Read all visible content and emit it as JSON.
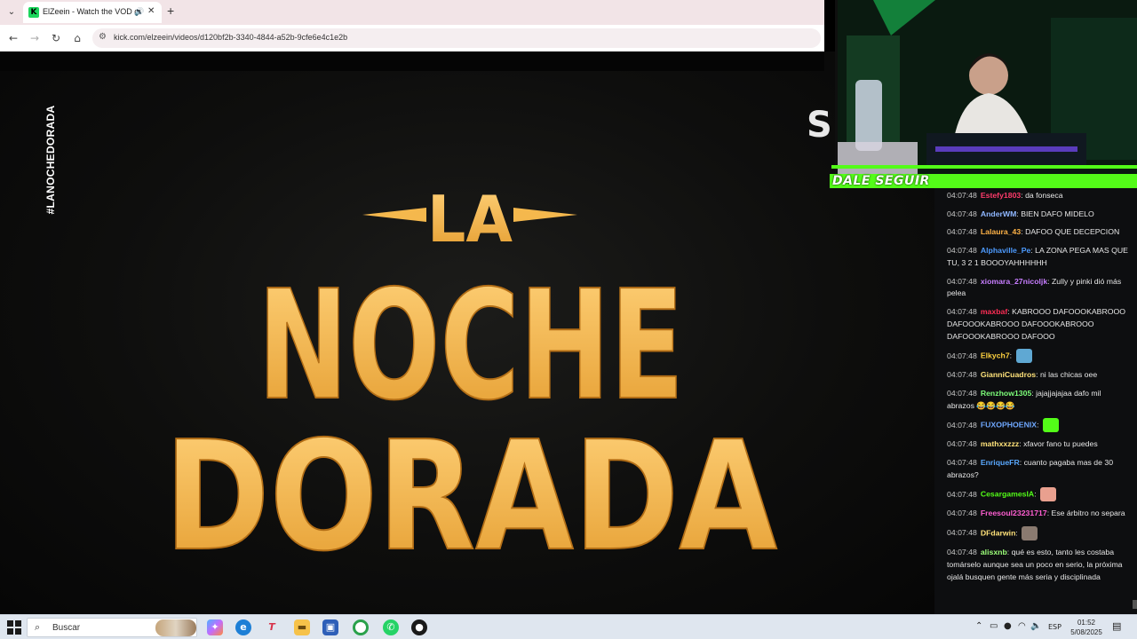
{
  "browser": {
    "tab_title": "ElZeein - Watch the VOD on",
    "url": "kick.com/elzeein/videos/d120bf2b-3340-4844-a52b-9cfe6e4c1e2b"
  },
  "video": {
    "hashtag": "#LANOCHEDORADA",
    "title_line1": "LA",
    "title_line2": "NOCHE",
    "title_line3": "DORADA",
    "title_color": "#f5b84d"
  },
  "overlay": {
    "follow_banner": "DALE SEGUIR",
    "accent": "#53fc18"
  },
  "chat": {
    "messages": [
      {
        "time": "04:07:48",
        "user": "Estefy1803",
        "color": "#ff3b6b",
        "text": "da fonseca"
      },
      {
        "time": "04:07:48",
        "user": "AnderWM",
        "color": "#8fb7ff",
        "text": "BIEN DAFO MIDELO"
      },
      {
        "time": "04:07:48",
        "user": "Lalaura_43",
        "color": "#ffb347",
        "text": "DAFOO QUE DECEPCION"
      },
      {
        "time": "04:07:48",
        "user": "Alphaville_Pe",
        "color": "#4d9bff",
        "text": "LA ZONA PEGA MAS QUE TU, 3 2 1 BOOOYAHHHHHH"
      },
      {
        "time": "04:07:48",
        "user": "xiomara_27nicoljk",
        "color": "#c77dff",
        "text": "Zully y pinki dió más pelea"
      },
      {
        "time": "04:07:48",
        "user": "maxbaf",
        "color": "#ff2d55",
        "text": "KABROOO DAFOOOKABROOO DAFOOOKABROOO DAFOOOKABROOO DAFOOOKABROOO DAFOOO"
      },
      {
        "time": "04:07:48",
        "user": "Elkych7",
        "color": "#ffd23f",
        "text": "",
        "emote": "#5fa8d3"
      },
      {
        "time": "04:07:48",
        "user": "GianniCuadros",
        "color": "#ffe27a",
        "text": "ni las chicas oee"
      },
      {
        "time": "04:07:48",
        "user": "Renzhow1305",
        "color": "#7dff7a",
        "text": "jajajjajajaa dafo mil abrazos 😂😂😂😂"
      },
      {
        "time": "04:07:48",
        "user": "FUXOPHOENIX",
        "color": "#6fa8ff",
        "text": "",
        "emote": "#53fc18"
      },
      {
        "time": "04:07:48",
        "user": "mathxxzzz",
        "color": "#ffe27a",
        "text": "xfavor fano tu puedes"
      },
      {
        "time": "04:07:48",
        "user": "EnriqueFR",
        "color": "#5aa9ff",
        "text": "cuanto pagaba mas de 30 abrazos?"
      },
      {
        "time": "04:07:48",
        "user": "CesargamesIA",
        "color": "#53fc18",
        "text": "",
        "emote": "#e9a08f"
      },
      {
        "time": "04:07:48",
        "user": "Freesoul23231717",
        "color": "#ff5fd2",
        "text": "Ese árbitro no separa"
      },
      {
        "time": "04:07:48",
        "user": "DFdarwin",
        "color": "#ffe27a",
        "text": "",
        "emote": "#8a7a70"
      },
      {
        "time": "04:07:48",
        "user": "alisxnb",
        "color": "#9dff7a",
        "text": "qué es esto, tanto les costaba tomárselo aunque sea un poco en serio, la próxima ojalá busquen gente más seria y disciplinada"
      }
    ]
  },
  "taskbar": {
    "search_placeholder": "Buscar",
    "lang": "ESP",
    "time": "01:52",
    "date": "5/08/2025"
  }
}
